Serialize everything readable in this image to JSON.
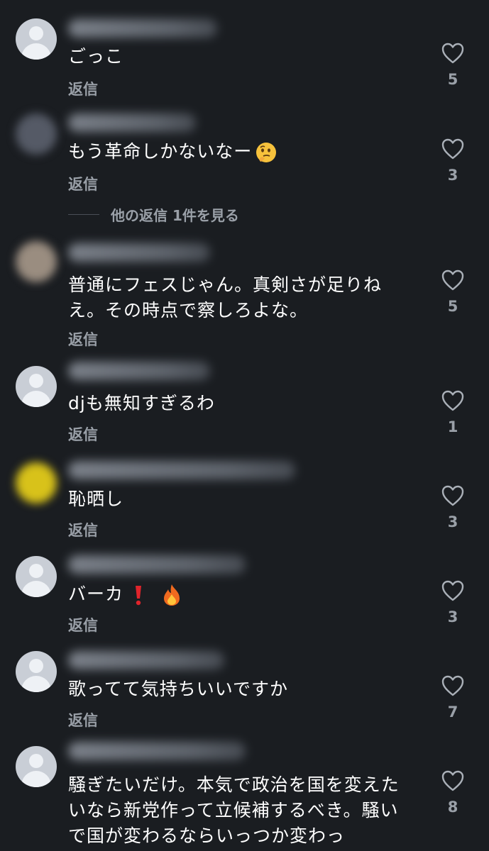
{
  "reply_label": "返信",
  "more_replies_label": "他の返信 1件を見る",
  "comments": [
    {
      "text": "ごっこ",
      "likes": "5"
    },
    {
      "text": "もう革命しかないなー",
      "likes": "3"
    },
    {
      "text": "普通にフェスじゃん。真剣さが足りねえ。その時点で察しろよな。",
      "likes": "5"
    },
    {
      "text": "djも無知すぎるわ",
      "likes": "1"
    },
    {
      "text": "恥晒し",
      "likes": "3"
    },
    {
      "text": "バーカ",
      "likes": "3"
    },
    {
      "text": "歌ってて気持ちいいですか",
      "likes": "7"
    },
    {
      "text": "騒ぎたいだけ。本気で政治を国を変えたいなら新党作って立候補するべき。騒いで国が変わるならいっつか変わっ",
      "likes": "8"
    }
  ]
}
